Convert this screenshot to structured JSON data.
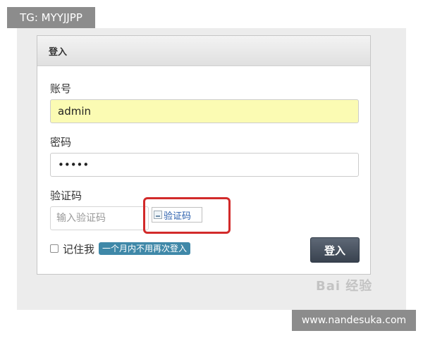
{
  "overlay": {
    "top_label": "TG: MYYJJPP",
    "bottom_label": "www.nandesuka.com",
    "watermark": "Bai 经验"
  },
  "login": {
    "title": "登入",
    "account_label": "账号",
    "account_value": "admin",
    "password_label": "密码",
    "password_value": "•••••",
    "captcha_label": "验证码",
    "captcha_placeholder": "输入验证码",
    "captcha_image_alt": "验证码",
    "remember_label": "记住我",
    "remember_badge": "一个月内不用再次登入",
    "submit_label": "登入"
  },
  "colors": {
    "accent": "#d22a2a",
    "input_fill": "#fbfbb3",
    "button": "#39424f",
    "badge": "#3f88a8"
  }
}
